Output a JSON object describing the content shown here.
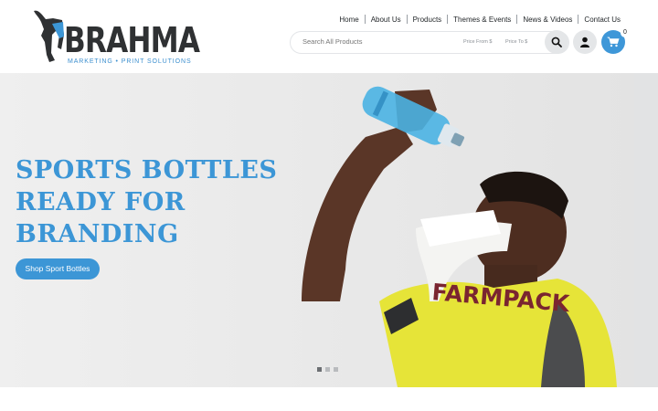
{
  "brand": {
    "name": "BRAHMA",
    "tagline": "MARKETING • PRINT SOLUTIONS",
    "primary_color": "#3c96d6",
    "dark_color": "#2f3133"
  },
  "nav": {
    "items": [
      "Home",
      "About Us",
      "Products",
      "Themes & Events",
      "News & Videos",
      "Contact Us"
    ]
  },
  "search": {
    "placeholder": "Search All Products",
    "price_from": "Price From $",
    "price_to": "Price To $",
    "icons": [
      "search-icon",
      "user-icon",
      "cart-icon"
    ]
  },
  "cart": {
    "count": "0"
  },
  "hero": {
    "title_lines": [
      "SPORTS BOTTLES",
      "READY FOR",
      "BRANDING"
    ],
    "button_label": "Shop Sport Bottles",
    "shirt_text": "FARMPACK",
    "slides": {
      "count": 3,
      "active": 1
    }
  }
}
